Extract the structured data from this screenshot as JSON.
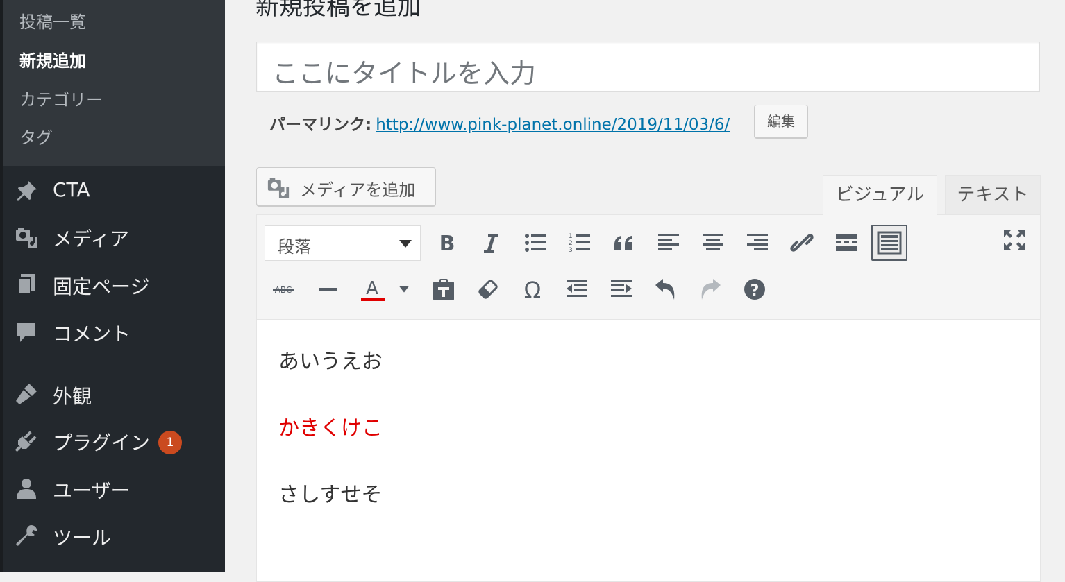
{
  "sidebar": {
    "submenu": [
      {
        "label": "投稿一覧",
        "current": false
      },
      {
        "label": "新規追加",
        "current": true
      },
      {
        "label": "カテゴリー",
        "current": false
      },
      {
        "label": "タグ",
        "current": false
      }
    ],
    "menu": [
      {
        "label": "CTA",
        "icon": "pin-icon"
      },
      {
        "label": "メディア",
        "icon": "media-icon"
      },
      {
        "label": "固定ページ",
        "icon": "pages-icon"
      },
      {
        "label": "コメント",
        "icon": "comment-icon"
      },
      {
        "label": "外観",
        "icon": "appearance-icon"
      },
      {
        "label": "プラグイン",
        "icon": "plugin-icon",
        "badge": "1"
      },
      {
        "label": "ユーザー",
        "icon": "user-icon"
      },
      {
        "label": "ツール",
        "icon": "wrench-icon"
      }
    ]
  },
  "header": {
    "title": "新規投稿を追加"
  },
  "post_title": {
    "placeholder": "ここにタイトルを入力"
  },
  "permalink": {
    "label": "パーマリンク:",
    "url": "http://www.pink-planet.online/2019/11/03/6/",
    "edit_label": "編集"
  },
  "media": {
    "add_label": "メディアを追加"
  },
  "editor_tabs": {
    "visual": "ビジュアル",
    "text": "テキスト"
  },
  "toolbar": {
    "format_select": "段落",
    "text_color": "#e00000"
  },
  "content": {
    "paragraphs": [
      {
        "text": "あいうえお",
        "color": "#333333"
      },
      {
        "text": "かきくけこ",
        "color": "#e00000"
      },
      {
        "text": "さしすせそ",
        "color": "#333333"
      }
    ]
  },
  "colors": {
    "sidebar_bg": "#23282d",
    "submenu_bg": "#32373c",
    "link": "#0073aa",
    "badge": "#ca4a1f"
  }
}
